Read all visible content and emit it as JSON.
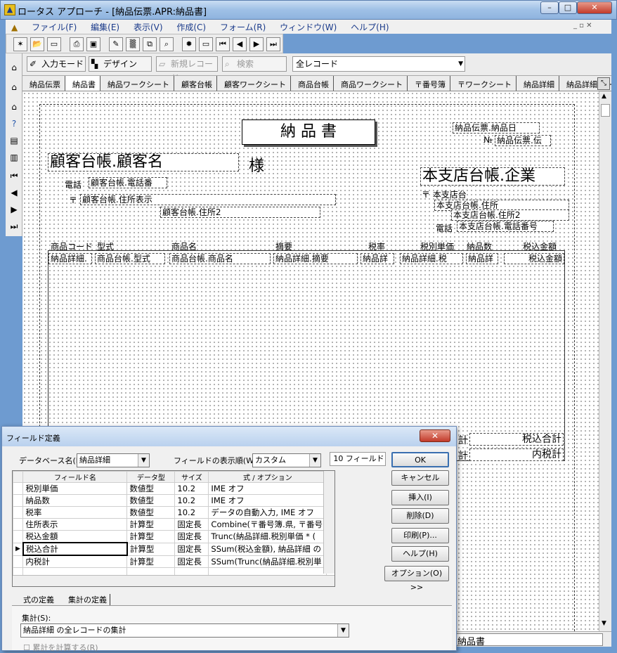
{
  "window": {
    "title": "ロータス アプローチ - [納品伝票.APR:納品書]"
  },
  "menu": [
    "ファイル(F)",
    "編集(E)",
    "表示(V)",
    "作成(C)",
    "フォーム(R)",
    "ウィンドウ(W)",
    "ヘルプ(H)"
  ],
  "toolbar2": {
    "input_mode": "入力モード",
    "design": "デザイン",
    "new_record": "新規レコード",
    "search": "検索",
    "record_select": "全レコード"
  },
  "tabs": [
    "納品伝票",
    "納品書",
    "納品ワークシート",
    "顧客台帳",
    "顧客ワークシート",
    "商品台帳",
    "商品ワークシート",
    "〒番号簿",
    "〒ワークシート",
    "納品詳細",
    "納品詳細ワークシ"
  ],
  "form": {
    "title": "納 品 書",
    "date_field": "納品伝票.納品日",
    "no_label": "№",
    "no_field": "納品伝票.伝",
    "customer_name": "顧客台帳.顧客名",
    "sama": "様",
    "tel_label": "電話",
    "tel_field": "顧客台帳.電話番",
    "postal_mark": "〒",
    "address_field": "顧客台帳.住所表示",
    "address2_field": "顧客台帳.住所2",
    "company_field": "本支店台帳.企業",
    "branch_postal": "〒 本支店台",
    "branch_addr": "本支店台帳.住所",
    "branch_addr2": "本支店台帳.住所2",
    "branch_tel_label": "電話",
    "branch_tel": "本支店台帳.電話番号",
    "headers": [
      "商品コード",
      "型式",
      "商品名",
      "摘要",
      "税率",
      "税別単価",
      "納品数",
      "税込金額"
    ],
    "row_fields": [
      "納品詳細.",
      "商品台帳.型式",
      "商品台帳.商品名",
      "納品詳細.摘要",
      "納品詳",
      "納品詳細.税",
      "納品詳",
      "税込金額"
    ],
    "total_tax_incl": "税込合計",
    "total_tax": "内税計",
    "total_prefix1": "計",
    "total_prefix2": "計",
    "status_text": "納品書"
  },
  "dialog": {
    "title": "フィールド定義",
    "db_label": "データベース名(B):",
    "db_value": "納品詳細",
    "order_label": "フィールドの表示順(W):",
    "order_value": "カスタム",
    "field_count": "10 フィールド",
    "columns": [
      "フィールド名",
      "データ型",
      "サイズ",
      "式 / オプション"
    ],
    "rows": [
      [
        "税別単価",
        "数値型",
        "10.2",
        "IME オフ"
      ],
      [
        "納品数",
        "数値型",
        "10.2",
        "IME オフ"
      ],
      [
        "税率",
        "数値型",
        "10.2",
        "データの自動入力, IME オフ"
      ],
      [
        "住所表示",
        "計算型",
        "固定長",
        "Combine(〒番号簿.県, 〒番号"
      ],
      [
        "税込金額",
        "計算型",
        "固定長",
        "Trunc(納品詳細.税別単価 * ("
      ],
      [
        "税込合計",
        "計算型",
        "固定長",
        "SSum(税込金額), 納品詳細 の"
      ],
      [
        "内税計",
        "計算型",
        "固定長",
        "SSum(Trunc(納品詳細.税別単"
      ]
    ],
    "buttons": {
      "ok": "OK",
      "cancel": "キャンセル",
      "insert": "挿入(I)",
      "delete": "削除(D)",
      "print": "印刷(P)...",
      "help": "ヘルプ(H)",
      "options": "オプション(O) >>"
    },
    "subtabs": [
      "式の定義",
      "集計の定義"
    ],
    "summary_label": "集計(S):",
    "summary_value": "納品詳細 の全レコードの集計",
    "cumulative": "累計を計算する(R)"
  }
}
